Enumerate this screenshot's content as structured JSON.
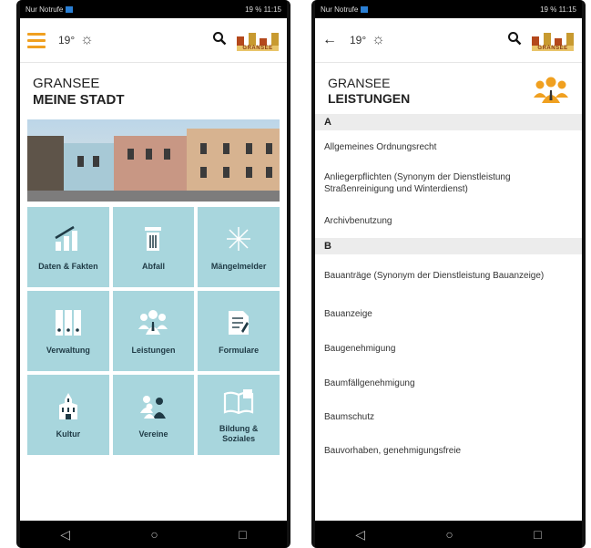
{
  "status": {
    "carrier": "Nur Notrufe",
    "right": "19 % 11:15"
  },
  "topbar": {
    "temp": "19°",
    "logo_text": "GRANSEE"
  },
  "home": {
    "title_line1": "GRANSEE",
    "title_line2": "MEINE STADT",
    "tiles": [
      {
        "label": "Daten & Fakten",
        "icon": "stats-chart-icon"
      },
      {
        "label": "Abfall",
        "icon": "trash-bin-icon"
      },
      {
        "label": "Mängelmelder",
        "icon": "sparkle-icon"
      },
      {
        "label": "Verwaltung",
        "icon": "binders-icon"
      },
      {
        "label": "Leistungen",
        "icon": "people-group-icon"
      },
      {
        "label": "Formulare",
        "icon": "form-document-icon"
      },
      {
        "label": "Kultur",
        "icon": "church-icon"
      },
      {
        "label": "Vereine",
        "icon": "club-people-icon"
      },
      {
        "label": "Bildung & Soziales",
        "icon": "open-book-icon"
      }
    ]
  },
  "services": {
    "title_line1": "GRANSEE",
    "title_line2": "LEISTUNGEN",
    "sections": [
      {
        "letter": "A",
        "items": [
          "Allgemeines Ordnungsrecht",
          "Anliegerpflichten (Synonym der Dienstleistung Straßenreinigung und Winterdienst)",
          "Archivbenutzung"
        ]
      },
      {
        "letter": "B",
        "items": [
          "Bauanträge (Synonym der Dienstleistung Bauanzeige)",
          "Bauanzeige",
          "Baugenehmigung",
          "Baumfällgenehmigung",
          "Baumschutz",
          "Bauvorhaben, genehmigungsfreie"
        ]
      }
    ]
  },
  "colors": {
    "accent": "#f0a020",
    "tile": "#a8d6dd",
    "tile_text": "#1f3a45"
  }
}
